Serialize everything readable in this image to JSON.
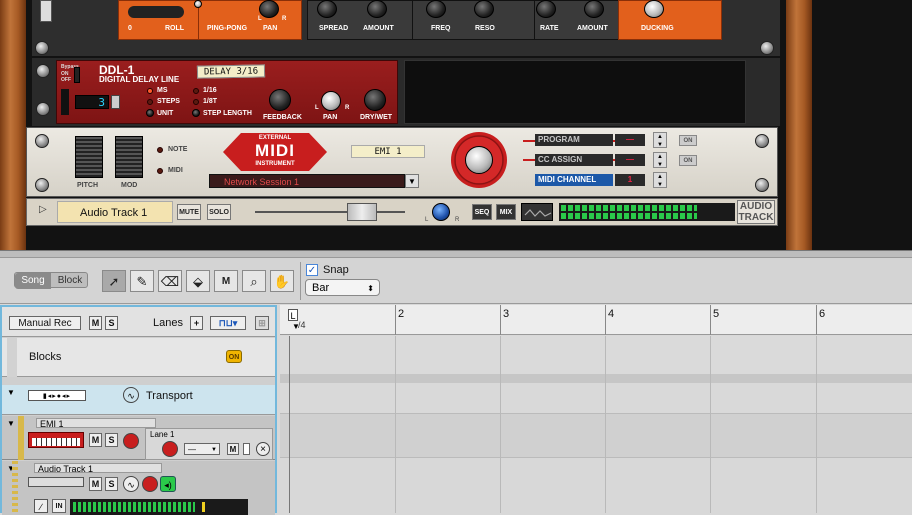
{
  "top_strip": {
    "labels": [
      "0",
      "ROLL",
      "PING-PONG",
      "PAN",
      "SPREAD",
      "AMOUNT",
      "FREQ",
      "RESO",
      "RATE",
      "AMOUNT",
      "DUCKING"
    ],
    "pan_l": "L",
    "pan_r": "R"
  },
  "ddl": {
    "bypass": "Bypass",
    "on": "ON",
    "off": "OFF",
    "model": "DDL-1",
    "name": "DIGITAL DELAY LINE",
    "patch": "DELAY 3/16",
    "display": "3",
    "unit_options": [
      "MS",
      "STEPS",
      "UNIT"
    ],
    "step_options": [
      "1/16",
      "1/8T",
      "STEP LENGTH"
    ],
    "knob_labels": [
      "FEEDBACK",
      "PAN",
      "DRY/WET"
    ],
    "pan_l": "L",
    "pan_r": "R"
  },
  "midi_device": {
    "pitch": "PITCH",
    "mod": "MOD",
    "note": "NOTE",
    "midi": "MIDI",
    "badge_top": "EXTERNAL",
    "badge_main": "MIDI",
    "badge_bottom": "INSTRUMENT",
    "patch_name": "EMI 1",
    "session": "Network Session 1",
    "rows": [
      {
        "label": "PROGRAM",
        "value": "—",
        "toggle": "ON"
      },
      {
        "label": "CC ASSIGN",
        "value": "—",
        "toggle": "ON"
      },
      {
        "label": "MIDI CHANNEL",
        "value": "1",
        "toggle": ""
      }
    ]
  },
  "audio_track_strip": {
    "name": "Audio Track 1",
    "mute": "MUTE",
    "solo": "SOLO",
    "pan_l": "L",
    "pan_r": "R",
    "seq": "SEQ",
    "mix": "MIX",
    "badge_line1": "AUDIO",
    "badge_line2": "TRACK"
  },
  "toolbar": {
    "mode_song": "Song",
    "mode_block": "Block",
    "tools": [
      "arrow-icon",
      "pencil-icon",
      "eraser-icon",
      "razor-icon",
      "mute-tool-icon",
      "magnify-icon",
      "hand-icon"
    ],
    "snap_label": "Snap",
    "snap_checked": true,
    "snap_value": "Bar"
  },
  "track_header": {
    "manual_rec": "Manual Rec",
    "m": "M",
    "s": "S",
    "lanes": "Lanes",
    "plus": "+"
  },
  "tracks": {
    "blocks": {
      "name": "Blocks",
      "badge": "ON"
    },
    "transport": {
      "name": "Transport"
    },
    "emi": {
      "name": "EMI 1",
      "lane": "Lane 1",
      "m": "M",
      "s": "S",
      "lane_m": "M",
      "remove": "×",
      "dropdown": "—"
    },
    "audio": {
      "name": "Audio Track 1",
      "m": "M",
      "s": "S",
      "in": "IN"
    }
  },
  "ruler": {
    "start_marker": "L",
    "time_sig": "/4",
    "bars": [
      "2",
      "3",
      "4",
      "5",
      "6"
    ]
  },
  "colors": {
    "accent_blue": "#72b8dc",
    "rack_orange": "#e2601c",
    "ddl_red": "#9a1e1e",
    "midi_red": "#c81e1e"
  }
}
